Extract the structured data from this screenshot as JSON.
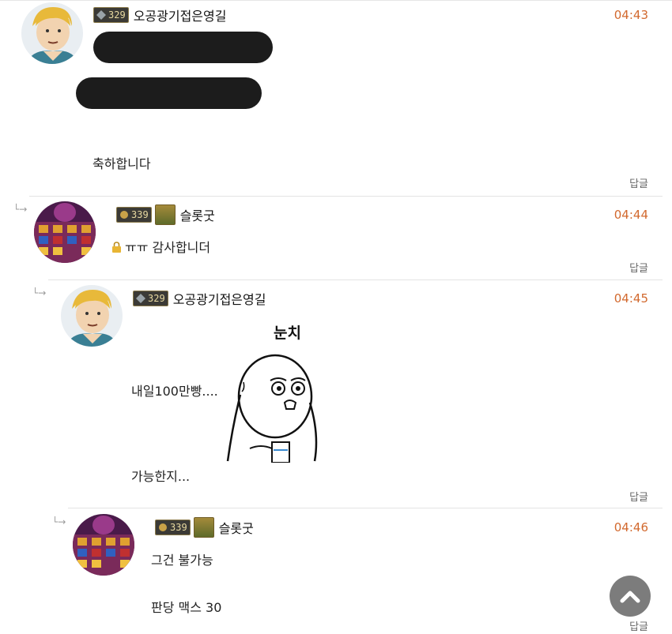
{
  "comments": [
    {
      "level": "329",
      "nickname": "오공광기접은영길",
      "time": "04:43",
      "body": [
        "축하합니다"
      ],
      "reply_label": "답글",
      "avatar": "cartoon-blond-man-avatar"
    },
    {
      "level": "339",
      "nickname": "슬롯굿",
      "time": "04:44",
      "body": [
        "ㅠㅠ 감사합니더"
      ],
      "reply_label": "답글",
      "avatar": "slot-game-avatar",
      "secret": true
    },
    {
      "level": "329",
      "nickname": "오공광기접은영길",
      "time": "04:45",
      "body": [
        "내일100만빵....",
        "가능한지..."
      ],
      "sticker_text": "눈치",
      "reply_label": "답글",
      "avatar": "cartoon-blond-man-avatar"
    },
    {
      "level": "339",
      "nickname": "슬롯굿",
      "time": "04:46",
      "body": [
        "그건 불가능",
        "판당 맥스 30"
      ],
      "reply_label": "답글",
      "avatar": "slot-game-avatar"
    }
  ],
  "reply_arrow": "└→",
  "colors": {
    "time": "#d2692e",
    "scroll_button": "#7c7c7c"
  },
  "icons": {
    "scroll_top": "chevron-up-icon",
    "secret": "lock-icon"
  }
}
